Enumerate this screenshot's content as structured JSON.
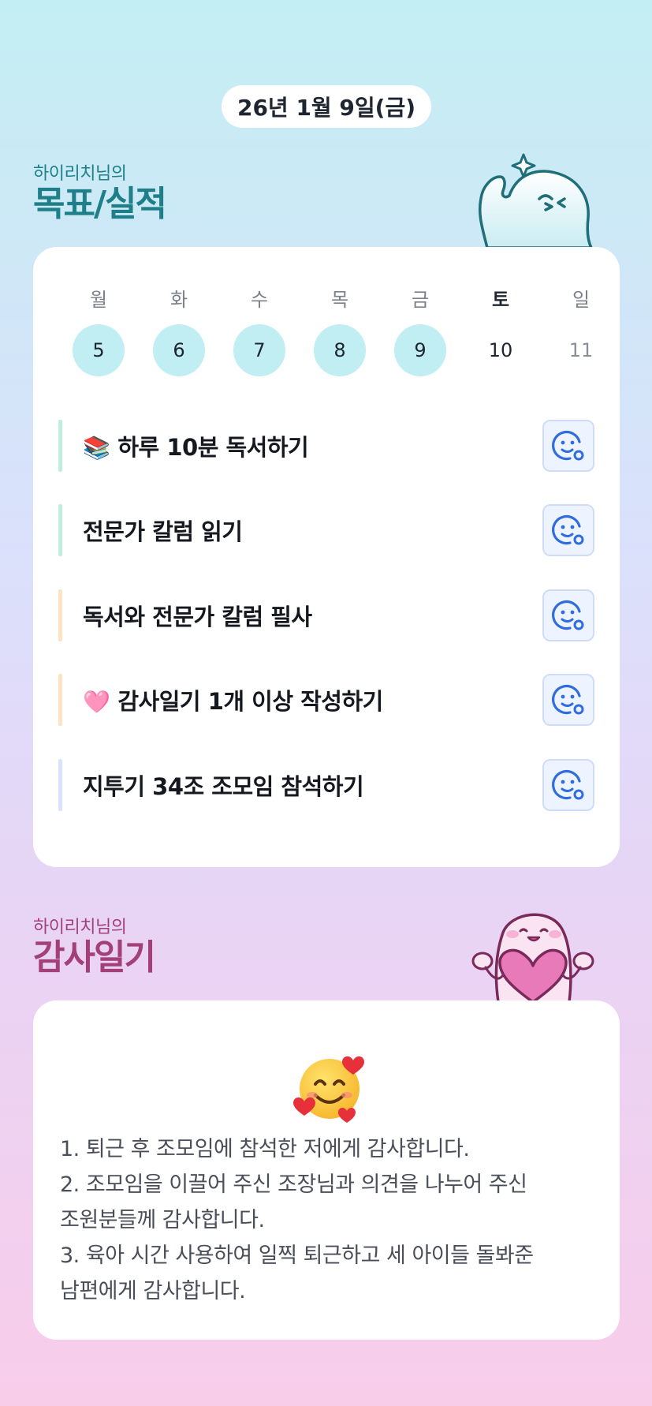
{
  "header": {
    "date": "26년 1월 9일(금)"
  },
  "goals_section": {
    "subtitle": "하이리치님의",
    "title": "목표/실적",
    "week": [
      {
        "name": "월",
        "date": "5",
        "status": "done"
      },
      {
        "name": "화",
        "date": "6",
        "status": "done"
      },
      {
        "name": "수",
        "date": "7",
        "status": "done"
      },
      {
        "name": "목",
        "date": "8",
        "status": "done"
      },
      {
        "name": "금",
        "date": "9",
        "status": "done"
      },
      {
        "name": "토",
        "date": "10",
        "status": "today"
      },
      {
        "name": "일",
        "date": "11",
        "status": "future"
      }
    ],
    "goals": [
      {
        "emoji": "📚",
        "label": "하루 10분 독서하기",
        "color": "#bfeedd",
        "icon": "smile-face-icon"
      },
      {
        "emoji": "",
        "label": "전문가 칼럼 읽기",
        "color": "#bfeedd",
        "icon": "smile-face-icon"
      },
      {
        "emoji": "",
        "label": "독서와 전문가 칼럼 필사",
        "color": "#fde3c4",
        "icon": "smile-face-icon"
      },
      {
        "emoji": "🩷",
        "label": "감사일기 1개 이상 작성하기",
        "color": "#fde3c4",
        "icon": "smile-face-icon"
      },
      {
        "emoji": "",
        "label": "지투기 34조 조모임 참석하기",
        "color": "#dbe2fb",
        "icon": "smile-face-icon"
      }
    ]
  },
  "gratitude_section": {
    "subtitle": "하이리치님의",
    "title": "감사일기",
    "mood_icon": "smiling-face-with-hearts-icon",
    "lines": [
      "1. 퇴근 후 조모임에 참석한 저에게 감사합니다.",
      "2. 조모임을 이끌어 주신 조장님과 의견을 나누어 주신",
      "조원분들께 감사합니다.",
      "3. 육아 시간 사용하여 일찍 퇴근하고 세 아이들 돌봐준",
      "남편에게 감사합니다."
    ]
  },
  "colors": {
    "accent_teal": "#1e7f88",
    "accent_plum": "#a3407a",
    "done_day": "#c1eef2",
    "button_icon": "#2f6ce0"
  }
}
